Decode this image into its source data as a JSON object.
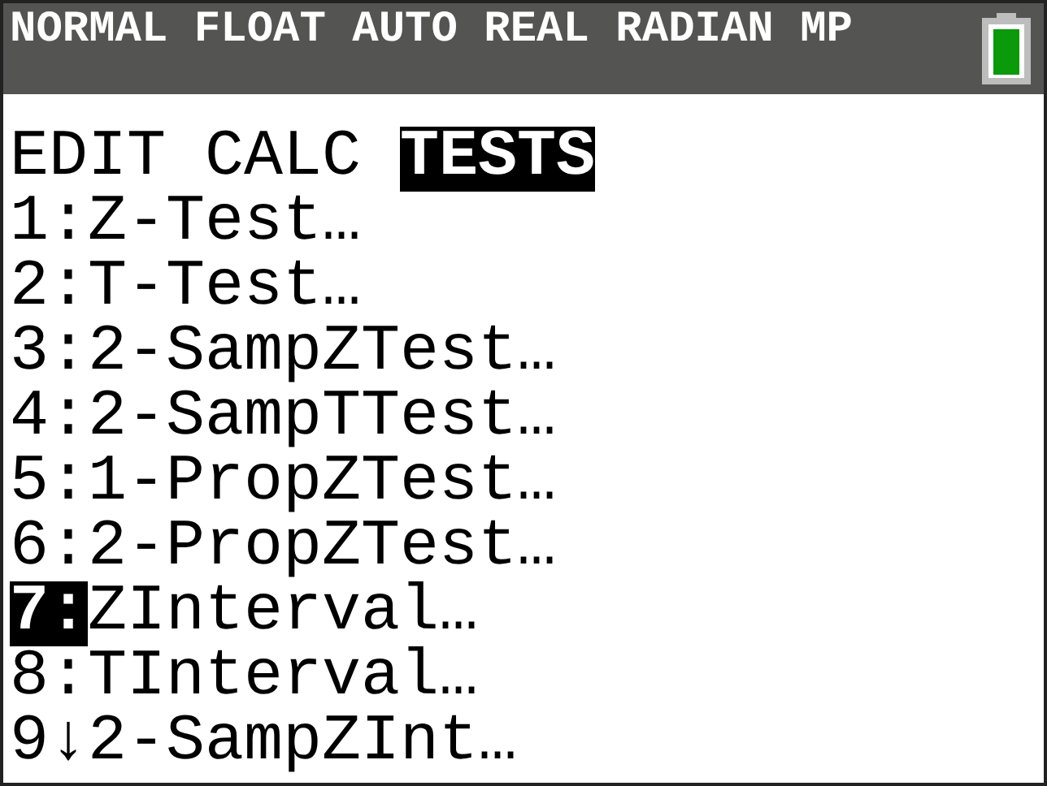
{
  "status_bar": {
    "modes": "NORMAL FLOAT AUTO REAL RADIAN MP"
  },
  "tabs": [
    {
      "label": "EDIT",
      "selected": false
    },
    {
      "label": "CALC",
      "selected": false
    },
    {
      "label": "TESTS",
      "selected": true
    }
  ],
  "menu_items": [
    {
      "number": "1",
      "separator": ":",
      "label": "Z-Test…",
      "selected": false
    },
    {
      "number": "2",
      "separator": ":",
      "label": "T-Test…",
      "selected": false
    },
    {
      "number": "3",
      "separator": ":",
      "label": "2-SampZTest…",
      "selected": false
    },
    {
      "number": "4",
      "separator": ":",
      "label": "2-SampTTest…",
      "selected": false
    },
    {
      "number": "5",
      "separator": ":",
      "label": "1-PropZTest…",
      "selected": false
    },
    {
      "number": "6",
      "separator": ":",
      "label": "2-PropZTest…",
      "selected": false
    },
    {
      "number": "7",
      "separator": ":",
      "label": "ZInterval…",
      "selected": true
    },
    {
      "number": "8",
      "separator": ":",
      "label": "TInterval…",
      "selected": false
    },
    {
      "number": "9",
      "separator": "↓",
      "label": "2-SampZInt…",
      "selected": false
    }
  ]
}
